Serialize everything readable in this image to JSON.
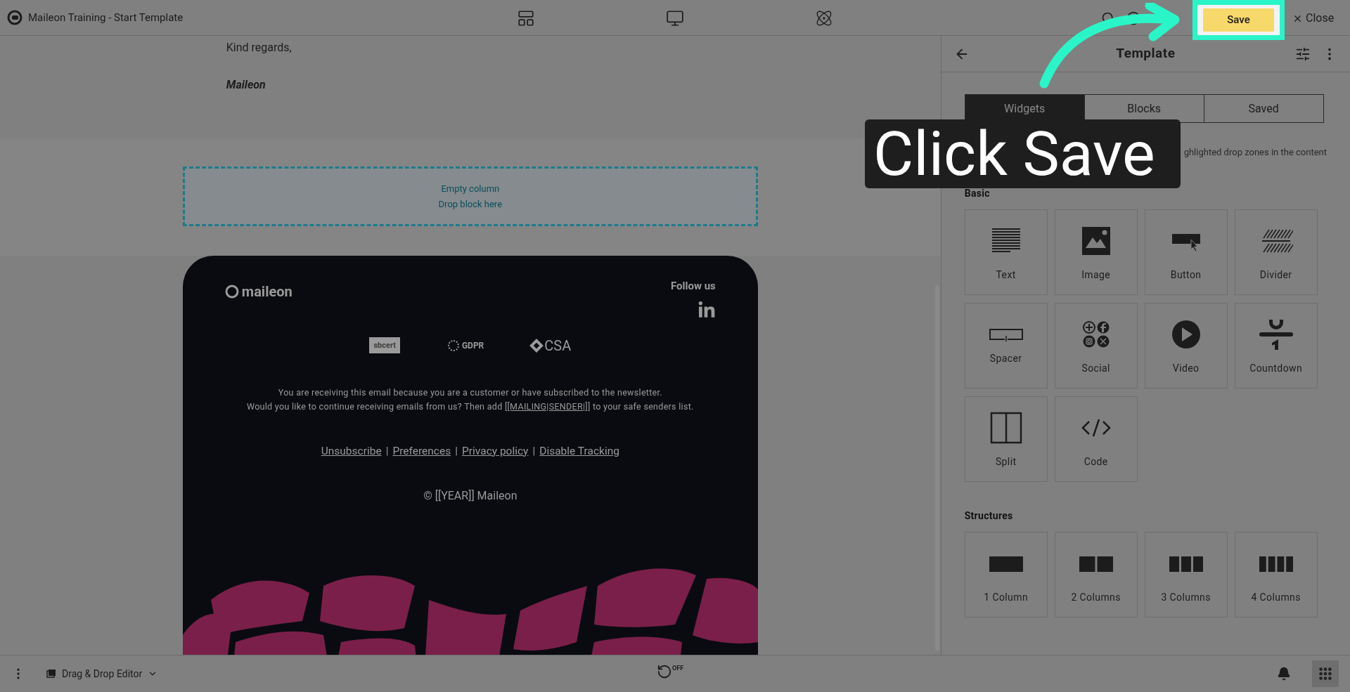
{
  "top_bar": {
    "title": "Maileon Training - Start Template",
    "save_button": "Save",
    "close_button": "Close"
  },
  "canvas": {
    "greeting": "Kind regards,",
    "signature": "Maileon",
    "drop_zone": {
      "line_1": "Empty column",
      "line_2": "Drop block here"
    },
    "footer": {
      "logo_text": "maileon",
      "follow_label": "Follow us",
      "certifications": [
        {
          "kind": "sbcert",
          "label": "sbcert"
        },
        {
          "kind": "gdpr",
          "label": "GDPR"
        },
        {
          "kind": "csa",
          "label": "CSA"
        }
      ],
      "notice_line_1": "You are receiving this email because you are a customer or have subscribed to the newsletter.",
      "notice_line_2_before": "Would you like to continue receiving emails from us? Then add",
      "notice_link": "[[MAILING|SENDER|]]",
      "notice_line_2_after": "to your safe senders list.",
      "links": [
        "Unsubscribe",
        "Preferences",
        "Privacy policy",
        "Disable Tracking"
      ],
      "separator": "|",
      "copyright": "© [[YEAR]] Maileon"
    }
  },
  "panel": {
    "title": "Template",
    "tabs": [
      {
        "label": "Widgets",
        "selected": true
      },
      {
        "label": "Blocks",
        "selected": false
      },
      {
        "label": "Saved",
        "selected": false
      }
    ],
    "description": "ghlighted drop zones in the content",
    "sections": [
      {
        "title": "Basic",
        "items": [
          {
            "label": "Text",
            "kind": "text"
          },
          {
            "label": "Image",
            "kind": "image"
          },
          {
            "label": "Button",
            "kind": "button"
          },
          {
            "label": "Divider",
            "kind": "divider"
          },
          {
            "label": "Spacer",
            "kind": "spacer"
          },
          {
            "label": "Social",
            "kind": "social"
          },
          {
            "label": "Video",
            "kind": "video"
          },
          {
            "label": "Countdown",
            "kind": "countdown"
          },
          {
            "label": "Split",
            "kind": "split"
          },
          {
            "label": "Code",
            "kind": "code"
          }
        ]
      },
      {
        "title": "Structures",
        "items": [
          {
            "label": "1 Column",
            "kind": "single"
          },
          {
            "label": "2 Columns",
            "kind": "double"
          },
          {
            "label": "3 Columns",
            "kind": "triple"
          },
          {
            "label": "4 Columns",
            "kind": "quadruple"
          }
        ]
      }
    ]
  },
  "bottom_bar": {
    "editor_label": "Drag & Drop Editor",
    "autosave_label": "OFF"
  },
  "callout": {
    "text": "Click Save"
  }
}
